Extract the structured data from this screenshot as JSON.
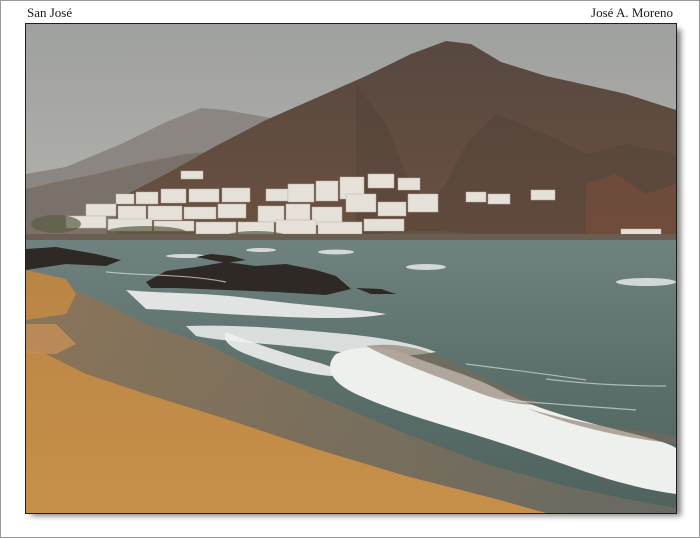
{
  "caption": {
    "location": "San José",
    "author": "José A. Moreno"
  },
  "colors": {
    "frame_background": "#ffffff",
    "sky": "#a5a7a4",
    "mountain": "#5e4c42",
    "sea": "#5f7471",
    "foam": "#eef0ee",
    "sand": "#c08a45"
  }
}
